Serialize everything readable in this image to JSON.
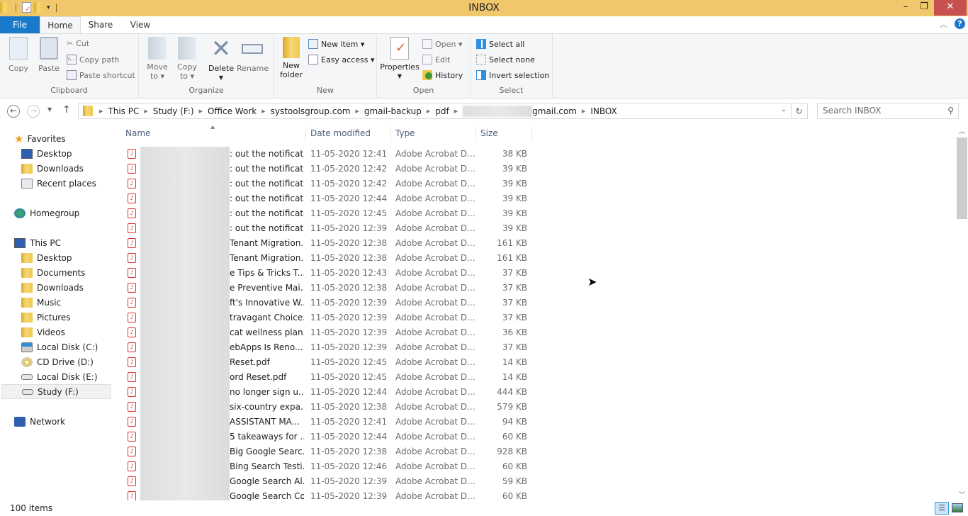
{
  "window": {
    "title": "INBOX",
    "controls": {
      "minimize": "–",
      "maximize": "❐",
      "close": "✕"
    }
  },
  "ribbon_tabs": [
    "File",
    "Home",
    "Share",
    "View"
  ],
  "ribbon": {
    "clipboard": {
      "label": "Clipboard",
      "copy": "Copy",
      "paste": "Paste",
      "cut": "Cut",
      "copy_path": "Copy path",
      "paste_shortcut": "Paste shortcut"
    },
    "organize": {
      "label": "Organize",
      "move_to": "Move",
      "move_to_2": "to ▾",
      "copy_to": "Copy",
      "copy_to_2": "to ▾",
      "delete": "Delete",
      "rename": "Rename"
    },
    "new": {
      "label": "New",
      "new_folder": "New",
      "new_folder_2": "folder",
      "new_item": "New item ▾",
      "easy_access": "Easy access ▾"
    },
    "open": {
      "label": "Open",
      "properties": "Properties",
      "open": "Open ▾",
      "edit": "Edit",
      "history": "History"
    },
    "select": {
      "label": "Select",
      "select_all": "Select all",
      "select_none": "Select none",
      "invert_selection": "Invert selection"
    }
  },
  "address": {
    "crumbs": [
      "This PC",
      "Study (F:)",
      "Office Work",
      "systoolsgroup.com",
      "gmail-backup",
      "pdf",
      "gmail.com",
      "INBOX"
    ],
    "search_placeholder": "Search INBOX"
  },
  "nav": {
    "favorites": "Favorites",
    "fav_items": [
      "Desktop",
      "Downloads",
      "Recent places"
    ],
    "homegroup": "Homegroup",
    "this_pc": "This PC",
    "pc_items": [
      "Desktop",
      "Documents",
      "Downloads",
      "Music",
      "Pictures",
      "Videos",
      "Local Disk (C:)",
      "CD Drive (D:)",
      "Local Disk (E:)",
      "Study (F:)"
    ],
    "network": "Network"
  },
  "columns": {
    "name": "Name",
    "date": "Date modified",
    "type": "Type",
    "size": "Size"
  },
  "files": [
    {
      "name": ": out the notificat...",
      "date": "11-05-2020 12:41",
      "type": "Adobe Acrobat D...",
      "size": "38 KB"
    },
    {
      "name": ": out the notificat...",
      "date": "11-05-2020 12:42",
      "type": "Adobe Acrobat D...",
      "size": "39 KB"
    },
    {
      "name": ": out the notificat...",
      "date": "11-05-2020 12:42",
      "type": "Adobe Acrobat D...",
      "size": "39 KB"
    },
    {
      "name": ": out the notificat...",
      "date": "11-05-2020 12:44",
      "type": "Adobe Acrobat D...",
      "size": "39 KB"
    },
    {
      "name": ": out the notificat...",
      "date": "11-05-2020 12:45",
      "type": "Adobe Acrobat D...",
      "size": "39 KB"
    },
    {
      "name": ": out the notificat...",
      "date": "11-05-2020 12:39",
      "type": "Adobe Acrobat D...",
      "size": "39 KB"
    },
    {
      "name": "Tenant Migration...",
      "date": "11-05-2020 12:38",
      "type": "Adobe Acrobat D...",
      "size": "161 KB"
    },
    {
      "name": "Tenant Migration...",
      "date": "11-05-2020 12:38",
      "type": "Adobe Acrobat D...",
      "size": "161 KB"
    },
    {
      "name": "e Tips & Tricks T...",
      "date": "11-05-2020 12:43",
      "type": "Adobe Acrobat D...",
      "size": "37 KB"
    },
    {
      "name": "e Preventive Mai...",
      "date": "11-05-2020 12:38",
      "type": "Adobe Acrobat D...",
      "size": "37 KB"
    },
    {
      "name": "ft's Innovative W...",
      "date": "11-05-2020 12:39",
      "type": "Adobe Acrobat D...",
      "size": "37 KB"
    },
    {
      "name": "travagant Choice...",
      "date": "11-05-2020 12:39",
      "type": "Adobe Acrobat D...",
      "size": "37 KB"
    },
    {
      "name": "cat wellness plan...",
      "date": "11-05-2020 12:39",
      "type": "Adobe Acrobat D...",
      "size": "36 KB"
    },
    {
      "name": "ebApps Is Reno...",
      "date": "11-05-2020 12:39",
      "type": "Adobe Acrobat D...",
      "size": "37 KB"
    },
    {
      "name": "Reset.pdf",
      "date": "11-05-2020 12:45",
      "type": "Adobe Acrobat D...",
      "size": "14 KB"
    },
    {
      "name": "ord Reset.pdf",
      "date": "11-05-2020 12:45",
      "type": "Adobe Acrobat D...",
      "size": "14 KB"
    },
    {
      "name": "no longer sign u...",
      "date": "11-05-2020 12:44",
      "type": "Adobe Acrobat D...",
      "size": "444 KB"
    },
    {
      "name": "six-country expa...",
      "date": "11-05-2020 12:38",
      "type": "Adobe Acrobat D...",
      "size": "579 KB"
    },
    {
      "name": "ASSISTANT MA...",
      "date": "11-05-2020 12:41",
      "type": "Adobe Acrobat D...",
      "size": "94 KB"
    },
    {
      "name": "5 takeaways for ...",
      "date": "11-05-2020 12:44",
      "type": "Adobe Acrobat D...",
      "size": "60 KB"
    },
    {
      "name": "Big Google Searc...",
      "date": "11-05-2020 12:38",
      "type": "Adobe Acrobat D...",
      "size": "928 KB"
    },
    {
      "name": "Bing Search Testi...",
      "date": "11-05-2020 12:46",
      "type": "Adobe Acrobat D...",
      "size": "60 KB"
    },
    {
      "name": "Google Search Al...",
      "date": "11-05-2020 12:39",
      "type": "Adobe Acrobat D...",
      "size": "59 KB"
    },
    {
      "name": "Google Search Co...",
      "date": "11-05-2020 12:39",
      "type": "Adobe Acrobat D...",
      "size": "60 KB"
    }
  ],
  "status": {
    "item_count": "100 items"
  },
  "colors": {
    "titlebar": "#f0c76b",
    "file_tab": "#1979ca",
    "close": "#c75050",
    "pdf_icon": "#e03030"
  }
}
